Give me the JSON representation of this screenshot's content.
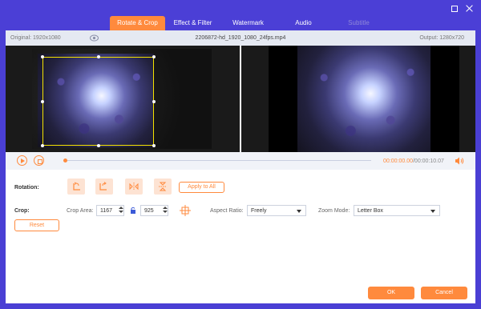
{
  "tabs": [
    {
      "label": "Rotate & Crop",
      "active": true
    },
    {
      "label": "Effect & Filter",
      "active": false
    },
    {
      "label": "Watermark",
      "active": false
    },
    {
      "label": "Audio",
      "active": false
    },
    {
      "label": "Subtitle",
      "active": false,
      "disabled": true
    }
  ],
  "info": {
    "original": "Original: 1920x1080",
    "filename": "2206872-hd_1920_1080_24fps.mp4",
    "output": "Output: 1280x720"
  },
  "playback": {
    "current_time": "00:00:00.00",
    "total_time": "/00:00:10.07",
    "progress": 0.0
  },
  "rotation": {
    "label": "Rotation:",
    "buttons": [
      "rotate-left-icon",
      "rotate-right-icon",
      "flip-horizontal-icon",
      "flip-vertical-icon"
    ],
    "apply_all": "Apply to All"
  },
  "crop": {
    "label": "Crop:",
    "area_label": "Crop Area:",
    "width": "1167",
    "height": "925",
    "aspect_label": "Aspect Ratio:",
    "aspect_value": "Freely",
    "zoom_label": "Zoom Mode:",
    "zoom_value": "Letter Box",
    "reset": "Reset"
  },
  "footer": {
    "ok": "OK",
    "cancel": "Cancel"
  },
  "colors": {
    "accent": "#ff8a3d",
    "titlebar": "#4b3fd6",
    "crop_border": "#f4e200"
  }
}
